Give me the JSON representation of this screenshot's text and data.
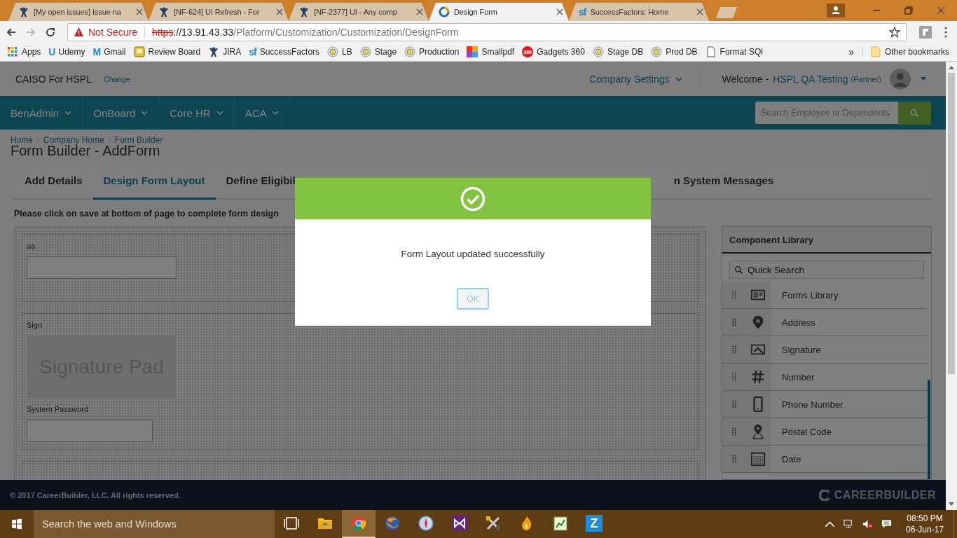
{
  "browser": {
    "tabs": [
      {
        "title": "[My open issues] Issue na",
        "kind": "figure",
        "selected": false
      },
      {
        "title": "[NF-624] UI Refresh - For",
        "kind": "figure",
        "selected": false
      },
      {
        "title": "[NF-2377] UI - Any comp",
        "kind": "figure",
        "selected": false
      },
      {
        "title": "Design Form",
        "kind": "ring",
        "selected": true
      },
      {
        "title": "SuccessFactors: Home",
        "kind": "letters",
        "icon_text": "sf",
        "selected": false
      }
    ],
    "address": {
      "security": "Not Secure",
      "scheme": "https",
      "host": "://13.91.43.33",
      "path": "/Platform/Customization/Customization/DesignForm"
    },
    "bookmarks": [
      {
        "label": "Apps",
        "kind": "grid"
      },
      {
        "label": "Udemy",
        "kind": "letter",
        "icon_text": "U"
      },
      {
        "label": "Gmail",
        "kind": "letter",
        "icon_text": "M"
      },
      {
        "label": "Review Board",
        "kind": "note"
      },
      {
        "label": "JIRA",
        "kind": "figure"
      },
      {
        "label": "SuccessFactors",
        "kind": "letter",
        "icon_text": "sf"
      },
      {
        "label": "LB",
        "kind": "target"
      },
      {
        "label": "Stage",
        "kind": "target"
      },
      {
        "label": "Production",
        "kind": "target"
      },
      {
        "label": "Smallpdf",
        "kind": "squares"
      },
      {
        "label": "Gadgets 360",
        "kind": "badge",
        "icon_text": "360"
      },
      {
        "label": "Stage DB",
        "kind": "target"
      },
      {
        "label": "Prod DB",
        "kind": "target"
      },
      {
        "label": "Format SQl",
        "kind": "page"
      }
    ],
    "overflow": "»",
    "other_bookmarks": "Other bookmarks"
  },
  "header": {
    "company": "CAISO For HSPL",
    "change_link": "Change",
    "settings": "Company Settings",
    "welcome": "Welcome -",
    "user": "HSPL QA Testing",
    "role": "(Partner)"
  },
  "nav": {
    "items": [
      "BenAdmin",
      "OnBoard",
      "Core HR",
      "ACA"
    ],
    "search_placeholder": "Search Employee or Dependents"
  },
  "breadcrumb": [
    "Home",
    "Company Home",
    "Form Builder"
  ],
  "page_title": "Form Builder - AddForm",
  "steps": [
    {
      "label": "Add Details",
      "selected": false
    },
    {
      "label": "Design Form Layout",
      "selected": true
    },
    {
      "label": "Define Eligibil",
      "selected": false
    },
    {
      "label": "n System Messages",
      "selected": false
    }
  ],
  "instruction": "Please click on save at bottom of page to complete form design",
  "canvas": {
    "sections": [
      {
        "fields": [
          {
            "kind": "text",
            "label": "aa"
          }
        ]
      },
      {
        "fields": [
          {
            "kind": "signature",
            "label": "Sign",
            "pad_text": "Signature Pad"
          },
          {
            "kind": "password",
            "label": "System Password"
          }
        ]
      }
    ]
  },
  "library": {
    "title": "Component Library",
    "search_placeholder": "Quick Search",
    "items": [
      {
        "label": "Forms Library",
        "kind": "list"
      },
      {
        "label": "Address",
        "kind": "pin"
      },
      {
        "label": "Signature",
        "kind": "signature"
      },
      {
        "label": "Number",
        "kind": "hash"
      },
      {
        "label": "Phone Number",
        "kind": "phone"
      },
      {
        "label": "Postal Code",
        "kind": "map-pin"
      },
      {
        "label": "Date",
        "kind": "calendar"
      }
    ]
  },
  "footer": {
    "copyright": "© 2017 CareerBuilder, LLC. All rights reserved.",
    "brand": "CAREERBUILDER"
  },
  "dialog": {
    "message": "Form Layout updated successfully",
    "button": "OK"
  },
  "taskbar": {
    "search_placeholder": "Search the web and Windows",
    "apps": [
      {
        "kind": "taskview",
        "selected": false
      },
      {
        "kind": "folder",
        "selected": false
      },
      {
        "kind": "ring",
        "selected": true
      },
      {
        "kind": "fox",
        "selected": false
      },
      {
        "kind": "compass",
        "selected": false
      },
      {
        "kind": "bowtie",
        "selected": false
      },
      {
        "kind": "tools",
        "selected": false
      },
      {
        "kind": "flame",
        "selected": false
      },
      {
        "kind": "chart",
        "selected": false
      },
      {
        "kind": "letter",
        "icon_text": "Z",
        "selected": false
      }
    ],
    "time": "08:50 PM",
    "date": "06-Jun-17"
  }
}
